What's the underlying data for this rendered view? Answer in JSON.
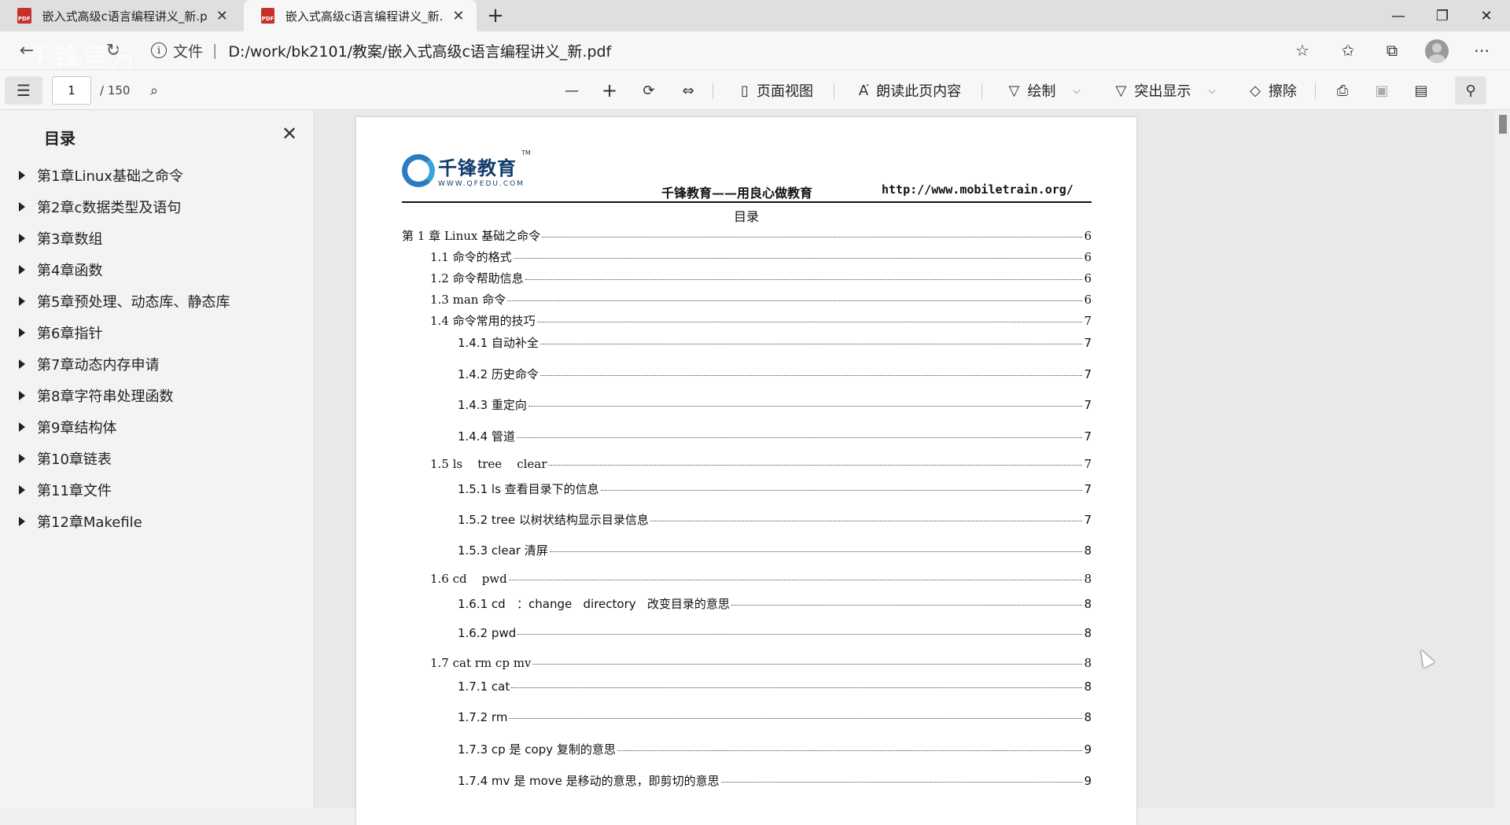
{
  "tabs": [
    {
      "title": "嵌入式高级c语言编程讲义_新.pdf"
    },
    {
      "title": "嵌入式高级c语言编程讲义_新.pdf"
    }
  ],
  "address": {
    "scheme": "文件",
    "url": "D:/work/bk2101/教案/嵌入式高级c语言编程讲义_新.pdf"
  },
  "watermark": "千锋官方",
  "toolbar": {
    "page_current": "1",
    "page_total": "/ 150",
    "page_view": "页面视图",
    "read_aloud": "朗读此页内容",
    "draw": "绘制",
    "highlight": "突出显示",
    "erase": "擦除"
  },
  "sidebar": {
    "title": "目录",
    "items": [
      "第1章Linux基础之命令",
      "第2章c数据类型及语句",
      "第3章数组",
      "第4章函数",
      "第5章预处理、动态库、静态库",
      "第6章指针",
      "第7章动态内存申请",
      "第8章字符串处理函数",
      "第9章结构体",
      "第10章链表",
      "第11章文件",
      "第12章Makefile"
    ]
  },
  "document": {
    "logo_cn": "千锋教育",
    "logo_en": "WWW.QFEDU.COM",
    "logo_tm": "TM",
    "header_left": "千锋教育——用良心做教育",
    "header_right": "http://www.mobiletrain.org/",
    "title": "目录",
    "toc": [
      {
        "label": "第 1 章  Linux 基础之命令",
        "page": "6"
      },
      {
        "label": "1.1  命令的格式",
        "page": "6"
      },
      {
        "label": "1.2  命令帮助信息",
        "page": "6"
      },
      {
        "label": "1.3 man 命令",
        "page": "6"
      },
      {
        "label": "1.4  命令常用的技巧",
        "page": "7"
      },
      {
        "label": "1.4.1  自动补全",
        "page": "7"
      },
      {
        "label": "1.4.2  历史命令",
        "page": "7"
      },
      {
        "label": "1.4.3  重定向",
        "page": "7"
      },
      {
        "label": "1.4.4  管道",
        "page": "7"
      },
      {
        "label": "1.5 ls    tree    clear",
        "page": "7"
      },
      {
        "label": "1.5.1 ls  查看目录下的信息",
        "page": "7"
      },
      {
        "label": "1.5.2 tree  以树状结构显示目录信息",
        "page": "7"
      },
      {
        "label": "1.5.3 clear  清屏",
        "page": "8"
      },
      {
        "label": "1.6 cd    pwd",
        "page": "8"
      },
      {
        "label": "1.6.1 cd   ：change   directory   改变目录的意思",
        "page": "8"
      },
      {
        "label": "1.6.2 pwd",
        "page": "8"
      },
      {
        "label": "1.7 cat rm cp mv",
        "page": "8"
      },
      {
        "label": "1.7.1 cat",
        "page": "8"
      },
      {
        "label": "1.7.2 rm",
        "page": "8"
      },
      {
        "label": "1.7.3 cp  是 copy  复制的意思",
        "page": "9"
      },
      {
        "label": "1.7.4 mv  是 move  是移动的意思，即剪切的意思",
        "page": "9"
      }
    ]
  }
}
